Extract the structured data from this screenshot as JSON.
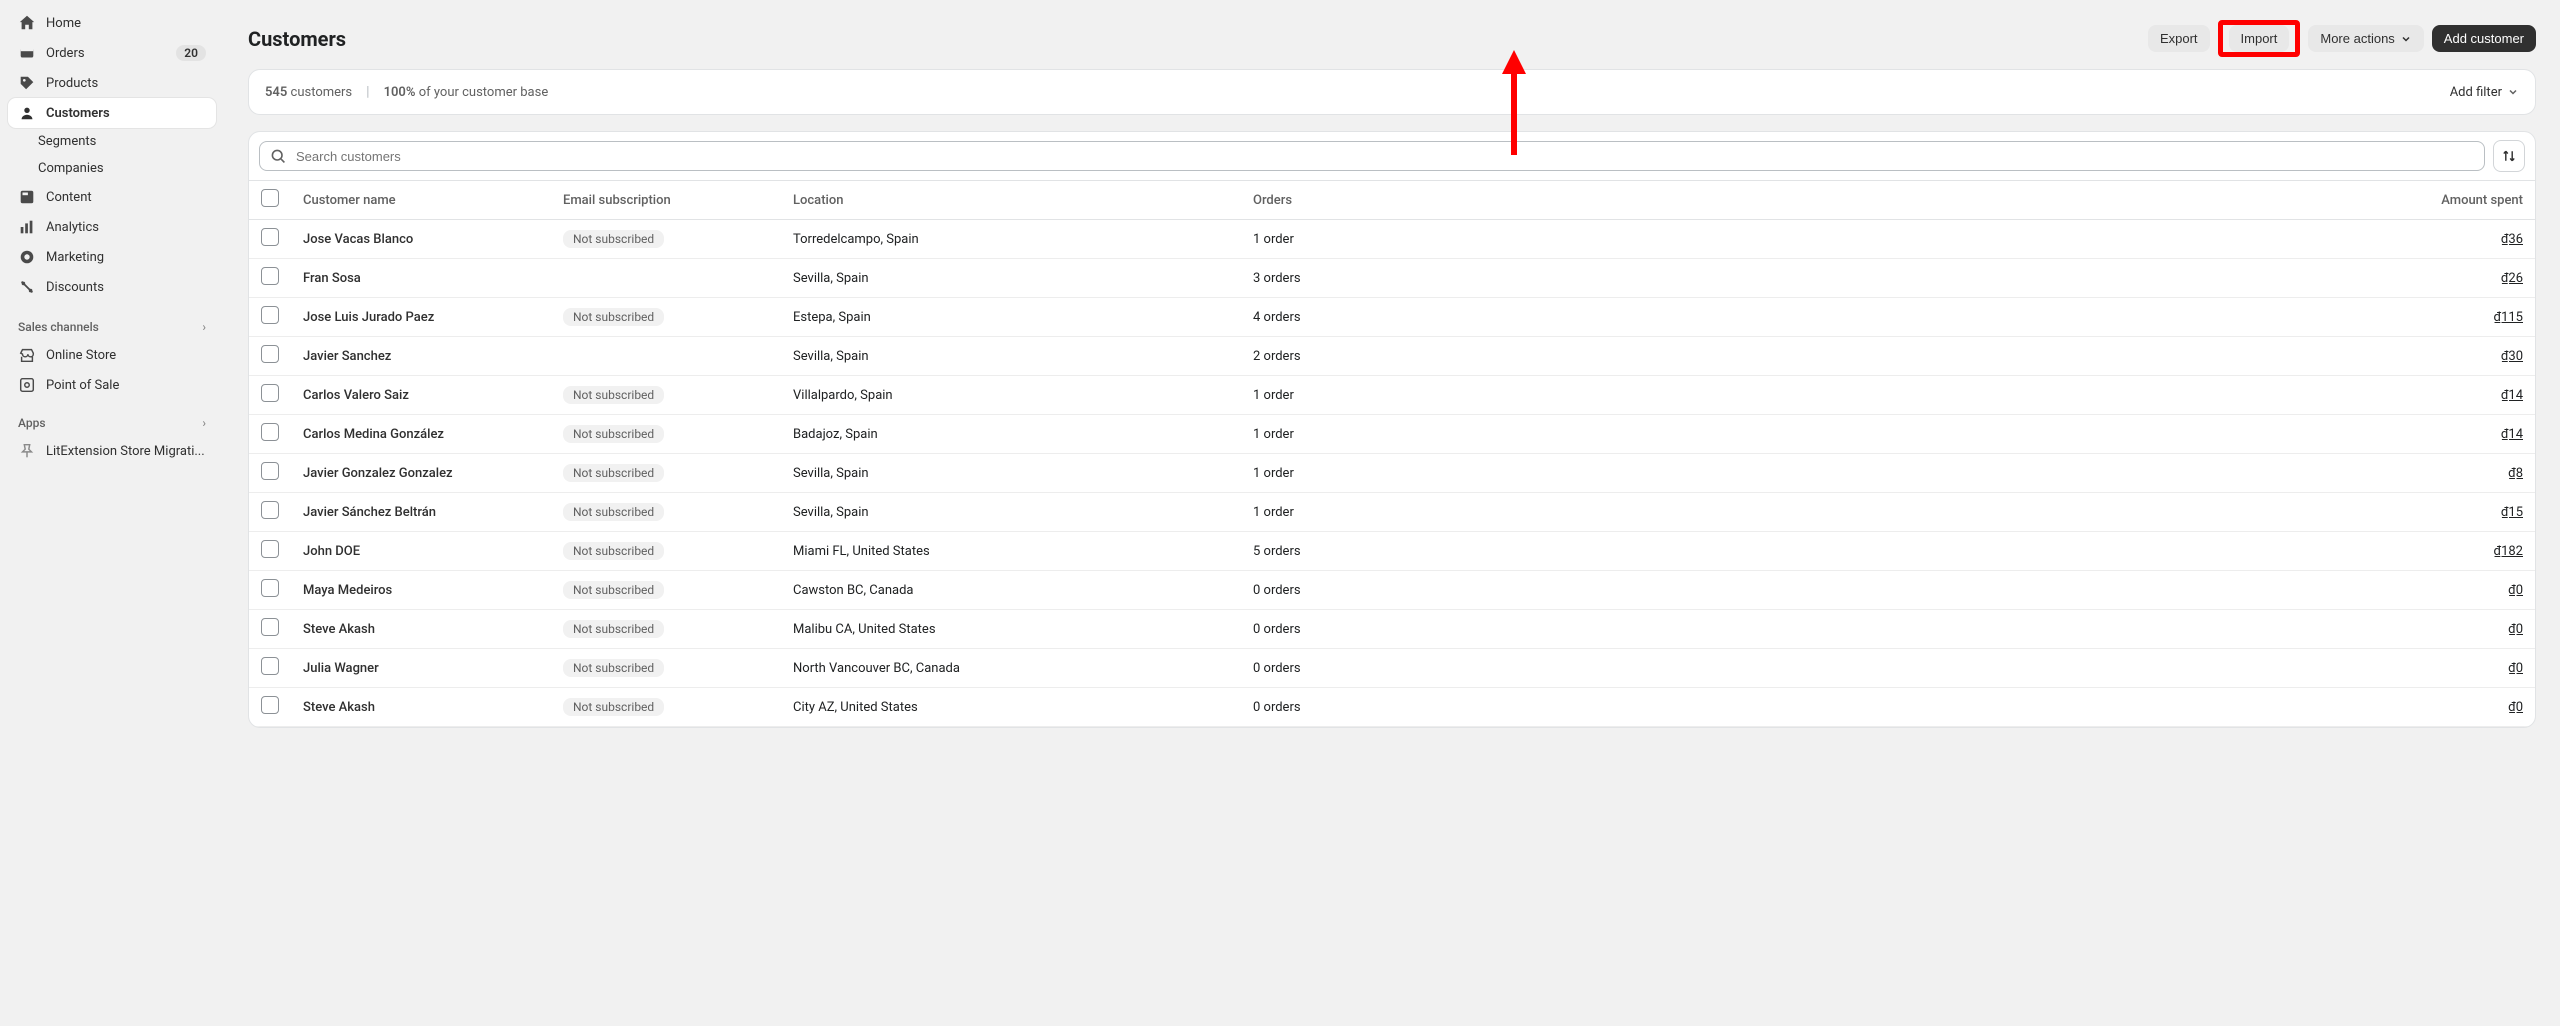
{
  "sidebar": {
    "home": "Home",
    "orders": "Orders",
    "orders_badge": "20",
    "products": "Products",
    "customers": "Customers",
    "segments": "Segments",
    "companies": "Companies",
    "content": "Content",
    "analytics": "Analytics",
    "marketing": "Marketing",
    "discounts": "Discounts",
    "sales_channels": "Sales channels",
    "online_store": "Online Store",
    "pos": "Point of Sale",
    "apps": "Apps",
    "lit": "LitExtension Store Migrati..."
  },
  "header": {
    "title": "Customers",
    "export": "Export",
    "import": "Import",
    "more": "More actions",
    "add": "Add customer"
  },
  "filter": {
    "count_num": "545",
    "count_text": "customers",
    "pct": "100%",
    "pct_text": "of your customer base",
    "add_filter": "Add filter"
  },
  "search": {
    "placeholder": "Search customers"
  },
  "table": {
    "headers": {
      "name": "Customer name",
      "sub": "Email subscription",
      "location": "Location",
      "orders": "Orders",
      "amount": "Amount spent"
    },
    "rows": [
      {
        "name": "Jose Vacas Blanco",
        "sub": "Not subscribed",
        "loc": "Torredelcampo, Spain",
        "orders": "1 order",
        "amount": "₫36"
      },
      {
        "name": "Fran Sosa",
        "sub": "",
        "loc": "Sevilla, Spain",
        "orders": "3 orders",
        "amount": "₫26"
      },
      {
        "name": "Jose Luis Jurado Paez",
        "sub": "Not subscribed",
        "loc": "Estepa, Spain",
        "orders": "4 orders",
        "amount": "₫115"
      },
      {
        "name": "Javier Sanchez",
        "sub": "",
        "loc": "Sevilla, Spain",
        "orders": "2 orders",
        "amount": "₫30"
      },
      {
        "name": "Carlos Valero Saiz",
        "sub": "Not subscribed",
        "loc": "Villalpardo, Spain",
        "orders": "1 order",
        "amount": "₫14"
      },
      {
        "name": "Carlos Medina González",
        "sub": "Not subscribed",
        "loc": "Badajoz, Spain",
        "orders": "1 order",
        "amount": "₫14"
      },
      {
        "name": "Javier Gonzalez Gonzalez",
        "sub": "Not subscribed",
        "loc": "Sevilla, Spain",
        "orders": "1 order",
        "amount": "₫8"
      },
      {
        "name": "Javier Sánchez Beltrán",
        "sub": "Not subscribed",
        "loc": "Sevilla, Spain",
        "orders": "1 order",
        "amount": "₫15"
      },
      {
        "name": "John DOE",
        "sub": "Not subscribed",
        "loc": "Miami FL, United States",
        "orders": "5 orders",
        "amount": "₫182"
      },
      {
        "name": "Maya Medeiros",
        "sub": "Not subscribed",
        "loc": "Cawston BC, Canada",
        "orders": "0 orders",
        "amount": "₫0"
      },
      {
        "name": "Steve Akash",
        "sub": "Not subscribed",
        "loc": "Malibu CA, United States",
        "orders": "0 orders",
        "amount": "₫0"
      },
      {
        "name": "Julia Wagner",
        "sub": "Not subscribed",
        "loc": "North Vancouver BC, Canada",
        "orders": "0 orders",
        "amount": "₫0"
      },
      {
        "name": "Steve Akash",
        "sub": "Not subscribed",
        "loc": "City AZ, United States",
        "orders": "0 orders",
        "amount": "₫0"
      }
    ]
  }
}
